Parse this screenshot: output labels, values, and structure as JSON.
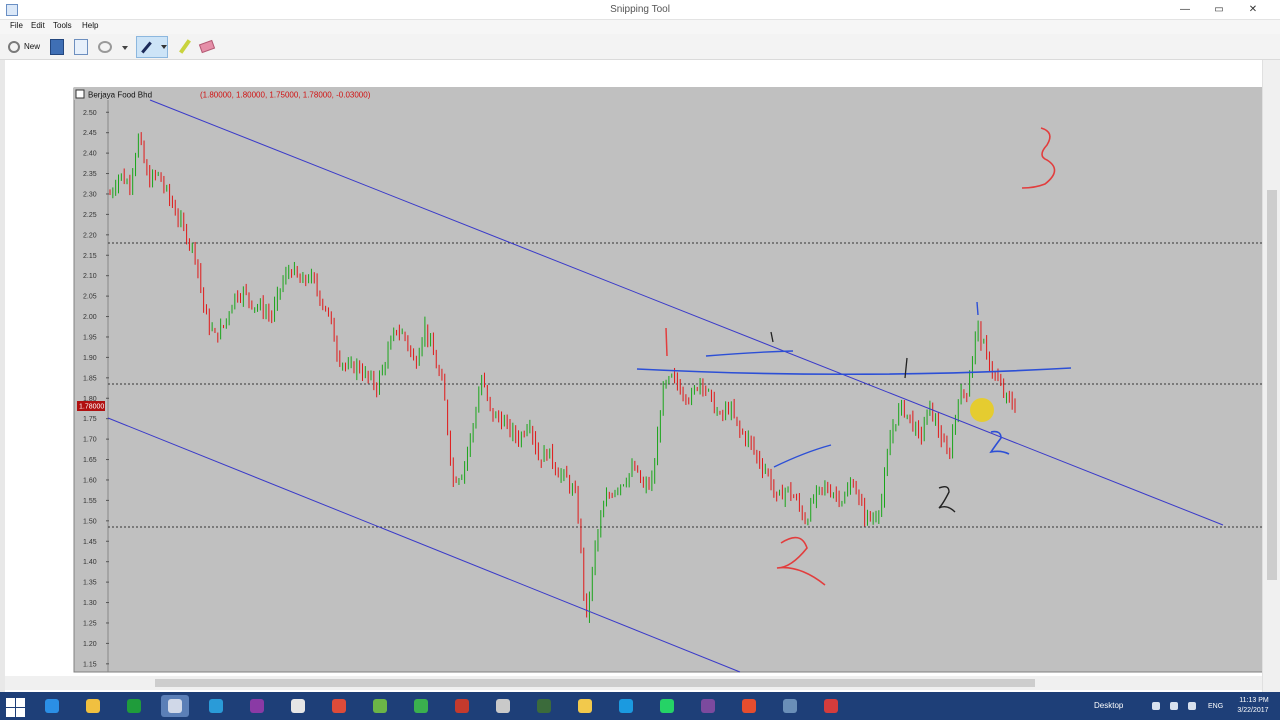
{
  "window": {
    "title": "Snipping Tool",
    "minimize": "—",
    "maximize": "▭",
    "close": "✕"
  },
  "menu": [
    "File",
    "Edit",
    "Tools",
    "Help"
  ],
  "toolbar": {
    "new_label": "New"
  },
  "chart_data": {
    "type": "candlestick",
    "title": "Berjaya Food Bhd",
    "ohlc_label": "(1.80000, 1.80000, 1.75000, 1.78000, -0.03000)",
    "last_price_label": "1.78000",
    "y_ticks": [
      "2.50",
      "2.45",
      "2.40",
      "2.35",
      "2.30",
      "2.25",
      "2.20",
      "2.15",
      "2.10",
      "2.05",
      "2.00",
      "1.95",
      "1.90",
      "1.85",
      "1.80",
      "1.75",
      "1.70",
      "1.65",
      "1.60",
      "1.55",
      "1.50",
      "1.45",
      "1.40",
      "1.35",
      "1.30",
      "1.25",
      "1.20",
      "1.15"
    ],
    "ylim": [
      1.13,
      2.53
    ],
    "horizontal_levels": [
      2.18,
      1.835,
      1.485
    ],
    "price_path": [
      2.3,
      2.35,
      2.32,
      2.44,
      2.33,
      2.35,
      2.3,
      2.25,
      2.2,
      2.15,
      2.0,
      1.95,
      1.98,
      2.05,
      2.06,
      2.03,
      2.02,
      2.0,
      2.08,
      2.12,
      2.08,
      2.1,
      2.05,
      2.0,
      1.9,
      1.87,
      1.88,
      1.85,
      1.83,
      1.9,
      1.97,
      1.95,
      1.88,
      1.98,
      1.9,
      1.82,
      1.6,
      1.62,
      1.72,
      1.85,
      1.76,
      1.75,
      1.72,
      1.7,
      1.75,
      1.65,
      1.67,
      1.62,
      1.6,
      1.55,
      1.25,
      1.45,
      1.55,
      1.58,
      1.6,
      1.63,
      1.58,
      1.6,
      1.82,
      1.85,
      1.82,
      1.8,
      1.85,
      1.8,
      1.75,
      1.78,
      1.72,
      1.7,
      1.65,
      1.62,
      1.55,
      1.58,
      1.55,
      1.5,
      1.56,
      1.58,
      1.57,
      1.55,
      1.6,
      1.52,
      1.5,
      1.55,
      1.72,
      1.78,
      1.75,
      1.7,
      1.78,
      1.72,
      1.65,
      1.8,
      1.82,
      1.98,
      1.9,
      1.85,
      1.8,
      1.78
    ]
  },
  "taskbar": {
    "apps": [
      {
        "icon": "internet-explorer-icon",
        "color": "#2b8fe6"
      },
      {
        "icon": "file-explorer-icon",
        "color": "#f0c040"
      },
      {
        "icon": "store-icon",
        "color": "#1f9c3b"
      },
      {
        "icon": "snipping-tool-icon",
        "color": "#d0d8e8"
      },
      {
        "icon": "send-icon",
        "color": "#2a9bd8"
      },
      {
        "icon": "onenote-icon",
        "color": "#8a3aa5"
      },
      {
        "icon": "calculator-icon",
        "color": "#e6e6e6"
      },
      {
        "icon": "chrome-icon",
        "color": "#dd4b39"
      },
      {
        "icon": "notes-app-icon",
        "color": "#6bb547"
      },
      {
        "icon": "globe-icon",
        "color": "#3ab04e"
      },
      {
        "icon": "bull-icon",
        "color": "#c43a2d"
      },
      {
        "icon": "chart-app-icon",
        "color": "#c9c9c9"
      },
      {
        "icon": "terminal-app-icon",
        "color": "#3b6b3b"
      },
      {
        "icon": "folder-icon",
        "color": "#f2c94c"
      },
      {
        "icon": "skype-icon",
        "color": "#1b9ae0"
      },
      {
        "icon": "whatsapp-icon",
        "color": "#25d366"
      },
      {
        "icon": "archive-icon",
        "color": "#7c4a9e"
      },
      {
        "icon": "shutter-icon",
        "color": "#e54d2e"
      },
      {
        "icon": "tools-icon",
        "color": "#6a8fb8"
      },
      {
        "icon": "photo-app-icon",
        "color": "#d43c3c"
      }
    ],
    "desktop_label": "Desktop",
    "lang": "ENG",
    "time": "11:13 PM",
    "date": "3/22/2017"
  }
}
